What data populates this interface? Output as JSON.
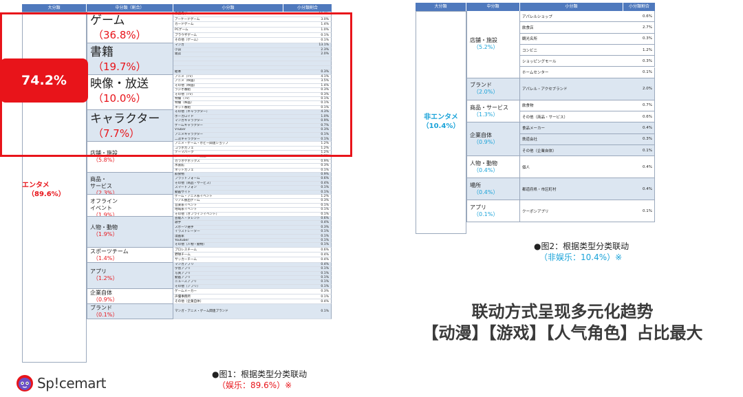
{
  "table1": {
    "headers": [
      "大分類",
      "中分類（割合）",
      "小分類",
      "小分類割合"
    ],
    "category": {
      "name": "エンタメ",
      "pct": "（89.6%）"
    },
    "badge": "74.2%",
    "groups": [
      {
        "name": "ゲーム",
        "pct": "（36.8%）",
        "size": "big",
        "rows": [
          [
            "家庭用ゲーム",
            "13.6%"
          ],
          [
            "アーケードゲーム",
            "3.0%"
          ],
          [
            "カードゲーム",
            "1.4%"
          ],
          [
            "PCゲーム",
            "1.0%"
          ],
          [
            "ブラウザゲーム",
            "0.1%"
          ],
          [
            "その他（ゲーム）",
            "0.1%"
          ]
        ]
      },
      {
        "name": "書籍",
        "pct": "（19.7%）",
        "size": "big",
        "rows": [
          [
            "マンガ",
            "13.1%"
          ],
          [
            "小説",
            "2.3%"
          ],
          [
            "雑誌",
            "2.0%"
          ],
          [
            "",
            ""
          ],
          [
            "",
            ""
          ],
          [
            "",
            ""
          ],
          [
            "絵本",
            "0.3%"
          ]
        ]
      },
      {
        "name": "映像・放送",
        "pct": "（10.0%）",
        "size": "big",
        "rows": [
          [
            "アニメ（TV）",
            "4.1%"
          ],
          [
            "アニメ（映画）",
            "3.5%"
          ],
          [
            "その他（映画）",
            "1.4%"
          ],
          [
            "ラジオ番組",
            "0.3%"
          ],
          [
            "その他（TV）",
            "0.3%"
          ],
          [
            "特撮（TV）",
            "0.1%"
          ],
          [
            "特撮（映画）",
            "0.1%"
          ],
          [
            "ネット番組",
            "0.1%"
          ]
        ]
      },
      {
        "name": "キャラクター",
        "pct": "（7.7%）",
        "size": "big",
        "rows": [
          [
            "その他（キャラクター）",
            "4.3%"
          ],
          [
            "ボーカロイド",
            "1.0%"
          ],
          [
            "マンガキャラクター",
            "0.9%"
          ],
          [
            "ゲームキャラクター",
            "0.7%"
          ],
          [
            "VTuber",
            "0.3%"
          ],
          [
            "アニメキャラクター",
            "0.1%"
          ],
          [
            "二次キャラクター",
            "0.1%"
          ]
        ]
      },
      {
        "name": "店舗・施設",
        "pct": "（5.8%）",
        "size": "small",
        "rows": [
          [
            "アニメ・ゲーム・ホビー関連ショップ",
            "1.2%"
          ],
          [
            "コラボカフェ",
            "1.2%"
          ],
          [
            "テーマパーク",
            "1.2%"
          ],
          [
            "アミューズメント施設",
            "1.0%"
          ],
          [
            "カラオケボックス",
            "0.9%"
          ],
          [
            "水族館",
            "0.3%"
          ],
          [
            "ネットカフェ",
            "0.1%"
          ]
        ]
      },
      {
        "name": "商品・\nサービス",
        "pct": "（2.3%）",
        "size": "small",
        "rows": [
          [
            "飲食物",
            "0.9%"
          ],
          [
            "プラットフォーム",
            "0.6%"
          ],
          [
            "その他（商品・サービス）",
            "0.4%"
          ],
          [
            "スマートフォン",
            "0.1%"
          ],
          [
            "動画サイト",
            "0.1%"
          ]
        ]
      },
      {
        "name": "オフライン\nイベント",
        "pct": "（1.9%）",
        "size": "small",
        "rows": [
          [
            "ゲーム・アニメ系イベント",
            "1.2%"
          ],
          [
            "リアル脱出ゲーム",
            "0.3%"
          ],
          [
            "音楽系イベント",
            "0.1%"
          ],
          [
            "地域系イベント",
            "0.1%"
          ],
          [
            "その他（オフラインイベント）",
            "0.1%"
          ]
        ]
      },
      {
        "name": "人物・動物",
        "pct": "（1.9%）",
        "size": "small",
        "rows": [
          [
            "芸能人・タレント",
            "0.6%"
          ],
          [
            "歌手",
            "0.4%"
          ],
          [
            "スポーツ選手",
            "0.3%"
          ],
          [
            "イラストレーター",
            "0.1%"
          ],
          [
            "漫画家",
            "0.1%"
          ],
          [
            "Youtuber",
            "0.1%"
          ],
          [
            "その他（人物・動物）",
            "0.1%"
          ]
        ]
      },
      {
        "name": "スポーツチーム",
        "pct": "（1.4%）",
        "size": "small",
        "rows": [
          [
            "プロレスチーム",
            "0.6%"
          ],
          [
            "野球チーム",
            "0.4%"
          ],
          [
            "サッカーチーム",
            "0.4%"
          ]
        ]
      },
      {
        "name": "アプリ",
        "pct": "（1.2%）",
        "size": "small",
        "rows": [
          [
            "マンガアプリ",
            "0.4%"
          ],
          [
            "学習アプリ",
            "0.1%"
          ],
          [
            "写真アプリ",
            "0.1%"
          ],
          [
            "動画アプリ",
            "0.1%"
          ],
          [
            "ニュースアプリ",
            "0.1%"
          ],
          [
            "その他（アプリ）",
            "0.1%"
          ]
        ]
      },
      {
        "name": "企業自体",
        "pct": "（0.9%）",
        "size": "small",
        "rows": [
          [
            "ゲームメーカー",
            "0.3%"
          ],
          [
            "声優事務所",
            "0.1%"
          ],
          [
            "その他（企業自体）",
            "0.4%"
          ]
        ]
      },
      {
        "name": "ブランド",
        "pct": "（0.1%）",
        "size": "small",
        "rows": [
          [
            "マンガ・アニメ・ゲーム関連ブランド",
            "0.1%"
          ]
        ]
      }
    ]
  },
  "table2": {
    "headers": [
      "大分類",
      "中分類",
      "小分類",
      "小分類割合"
    ],
    "category": {
      "name": "非エンタメ",
      "pct": "（10.4%）"
    },
    "groups": [
      {
        "name": "店舗・施設",
        "pct": "（5.2%）",
        "rows": [
          [
            "アパレルショップ",
            "0.6%"
          ],
          [
            "飲食店",
            "2.7%"
          ],
          [
            "観光名所",
            "0.3%"
          ],
          [
            "コンビニ",
            "1.2%"
          ],
          [
            "ショッピングモール",
            "0.3%"
          ],
          [
            "ホームセンター",
            "0.1%"
          ]
        ]
      },
      {
        "name": "ブランド",
        "pct": "（2.0%）",
        "rows": [
          [
            "アパレル・アクセブランド",
            "2.0%"
          ]
        ]
      },
      {
        "name": "商品・サービス",
        "pct": "（1.3%）",
        "rows": [
          [
            "飲食物",
            "0.7%"
          ],
          [
            "その他（商品・サービス）",
            "0.6%"
          ]
        ]
      },
      {
        "name": "企業自体",
        "pct": "（0.9%）",
        "rows": [
          [
            "食品メーカー",
            "0.4%"
          ],
          [
            "鉄道会社",
            "0.3%"
          ],
          [
            "その他（企業自体）",
            "0.1%"
          ]
        ]
      },
      {
        "name": "人物・動物",
        "pct": "（0.4%）",
        "rows": [
          [
            "個人",
            "0.4%"
          ]
        ]
      },
      {
        "name": "場所",
        "pct": "（0.4%）",
        "rows": [
          [
            "都道府県・市区町村",
            "0.4%"
          ]
        ]
      },
      {
        "name": "アプリ",
        "pct": "（0.1%）",
        "rows": [
          [
            "クーポンアプリ",
            "0.1%"
          ]
        ]
      }
    ]
  },
  "captions": {
    "fig1": {
      "line1": "●图1：根据类型分类联动",
      "line2": "（娱乐：89.6%）※"
    },
    "fig2": {
      "line1": "●图2：根据类型分类联动",
      "line2": "（非娱乐：10.4%）※"
    }
  },
  "headline": {
    "line1": "联动方式呈现多元化趋势",
    "line2": "【动漫】【游戏】【人气角色】占比最大"
  },
  "logo": {
    "text": "Sp!cemart"
  },
  "colors": {
    "header_blue": "#4f79bd",
    "alt_row": "#dce6f1",
    "accent_red": "#e8141a",
    "accent_cyan": "#1aa3d9"
  }
}
